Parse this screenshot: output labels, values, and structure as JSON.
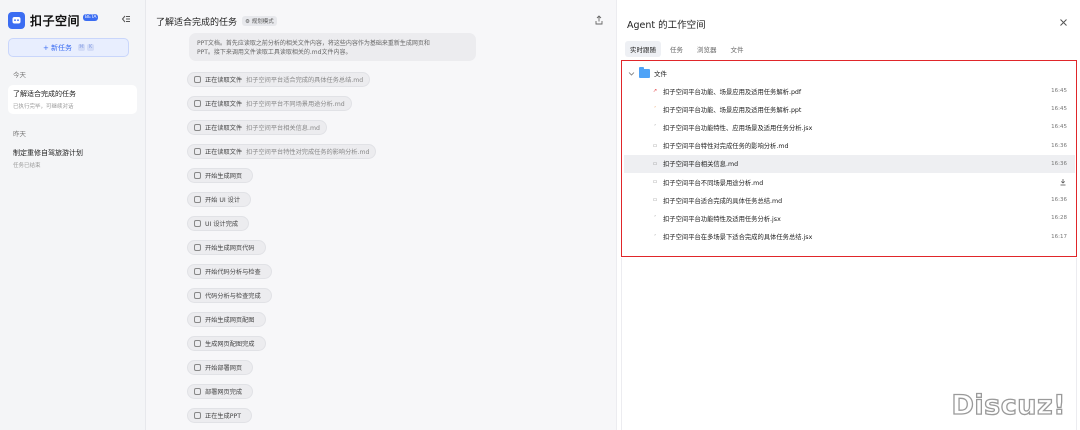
{
  "sidebar": {
    "brand": "扣子空间",
    "beta": "BETA",
    "new_task": "+ 新任务",
    "groups": [
      {
        "label": "今天",
        "tasks": [
          {
            "title": "了解适合完成的任务",
            "sub": "已执行完毕，可继续对话"
          }
        ]
      },
      {
        "label": "昨天",
        "tasks": [
          {
            "title": "制定重修自驾旅游计划",
            "sub": "任务已结束"
          }
        ]
      }
    ]
  },
  "chat": {
    "title": "了解适合完成的任务",
    "badge": "规划模式",
    "summary_line1": "PPT文档。首先应读取之前分析的相关文件内容，将这些内容作为基础来重新生成网页和",
    "summary_line2": "PPT。接下来调用文件读取工具读取相关的.md文件内容。",
    "steps": [
      {
        "label": "正在读取文件",
        "file": "扣子空间平台适合完成的具体任务总结.md"
      },
      {
        "label": "正在读取文件",
        "file": "扣子空间平台不同场景用途分析.md"
      },
      {
        "label": "正在读取文件",
        "file": "扣子空间平台相关信息.md"
      },
      {
        "label": "正在读取文件",
        "file": "扣子空间平台特性对完成任务的影响分析.md"
      },
      {
        "label": "开始生成网页",
        "file": ""
      },
      {
        "label": "开始 UI 设计",
        "file": ""
      },
      {
        "label": "UI 设计完成",
        "file": ""
      },
      {
        "label": "开始生成网页代码",
        "file": ""
      },
      {
        "label": "开始代码分析与检查",
        "file": ""
      },
      {
        "label": "代码分析与检查完成",
        "file": ""
      },
      {
        "label": "开始生成网页配图",
        "file": ""
      },
      {
        "label": "生成网页配图完成",
        "file": ""
      },
      {
        "label": "开始部署网页",
        "file": ""
      },
      {
        "label": "部署网页完成",
        "file": ""
      },
      {
        "label": "正在生成PPT",
        "file": ""
      }
    ]
  },
  "workspace": {
    "title": "Agent 的工作空间",
    "tabs": [
      "实时跟随",
      "任务",
      "浏览器",
      "文件"
    ],
    "folder": "文件",
    "files": [
      {
        "name": "扣子空间平台功能、场景应用及适用任务解析.pdf",
        "time": "16:45",
        "icon": "pdf-icon"
      },
      {
        "name": "扣子空间平台功能、场景应用及适用任务解析.ppt",
        "time": "16:45",
        "icon": "ppt-icon"
      },
      {
        "name": "扣子空间平台功能特性、应用场景及适用任务分析.jsx",
        "time": "16:45",
        "icon": "jsx-icon"
      },
      {
        "name": "扣子空间平台特性对完成任务的影响分析.md",
        "time": "16:36",
        "icon": "md-icon"
      },
      {
        "name": "扣子空间平台相关信息.md",
        "time": "16:36",
        "icon": "md-icon"
      },
      {
        "name": "扣子空间平台不同场景用途分析.md",
        "time": "",
        "icon": "md-icon"
      },
      {
        "name": "扣子空间平台适合完成的具体任务总结.md",
        "time": "16:36",
        "icon": "md-icon"
      },
      {
        "name": "扣子空间平台功能特性及适用任务分析.jsx",
        "time": "16:28",
        "icon": "jsx-icon"
      },
      {
        "name": "扣子空间平台在多场景下适合完成的具体任务总结.jsx",
        "time": "16:17",
        "icon": "jsx-icon"
      }
    ]
  },
  "watermark": "Discuz!"
}
